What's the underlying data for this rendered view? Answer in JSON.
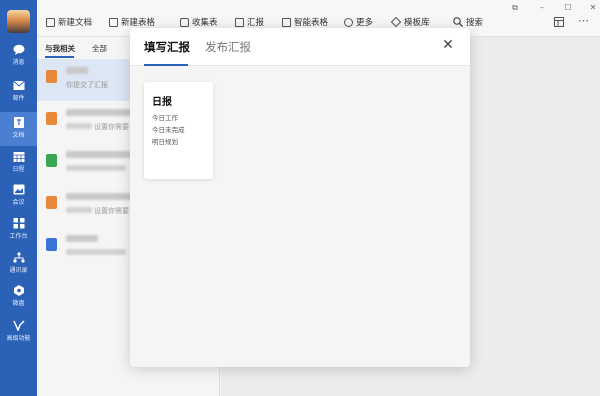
{
  "rail": {
    "items": [
      {
        "label": "消息",
        "icon": "chat-bubble-icon"
      },
      {
        "label": "邮件",
        "icon": "mail-icon"
      },
      {
        "label": "文档",
        "icon": "document-icon"
      },
      {
        "label": "日程",
        "icon": "calendar-icon"
      },
      {
        "label": "会议",
        "icon": "meeting-icon"
      },
      {
        "label": "工作台",
        "icon": "grid-icon"
      },
      {
        "label": "通讯录",
        "icon": "contacts-icon"
      },
      {
        "label": "微盘",
        "icon": "cloud-disk-icon"
      },
      {
        "label": "高级功能",
        "icon": "advanced-icon"
      }
    ],
    "active_index": 2,
    "color": "#2c61b8"
  },
  "toolbar": {
    "new_doc": "新建文档",
    "new_sheet": "新建表格",
    "collect_form": "收集表",
    "report": "汇报",
    "smart_sheet": "智能表格",
    "more": "更多",
    "template": "模板库",
    "search": "搜索"
  },
  "panel": {
    "tabs": [
      "与我相关",
      "全部"
    ],
    "rows": [
      {
        "subtitle": "你提交了汇报",
        "doc_color": "#e8893a",
        "selected": true
      },
      {
        "subtitle": "设置你需要",
        "doc_color": "#e8893a",
        "selected": false
      },
      {
        "subtitle": "",
        "doc_color": "#3aa655",
        "selected": false
      },
      {
        "subtitle": "设置你需要",
        "doc_color": "#e8893a",
        "selected": false
      },
      {
        "subtitle": "",
        "doc_color": "#3b73d6",
        "selected": false
      }
    ]
  },
  "modal": {
    "tabs": [
      "填写汇报",
      "发布汇报"
    ],
    "card": {
      "title": "日报",
      "lines": [
        "今日工作",
        "今日未完成",
        "明日规划"
      ]
    }
  }
}
